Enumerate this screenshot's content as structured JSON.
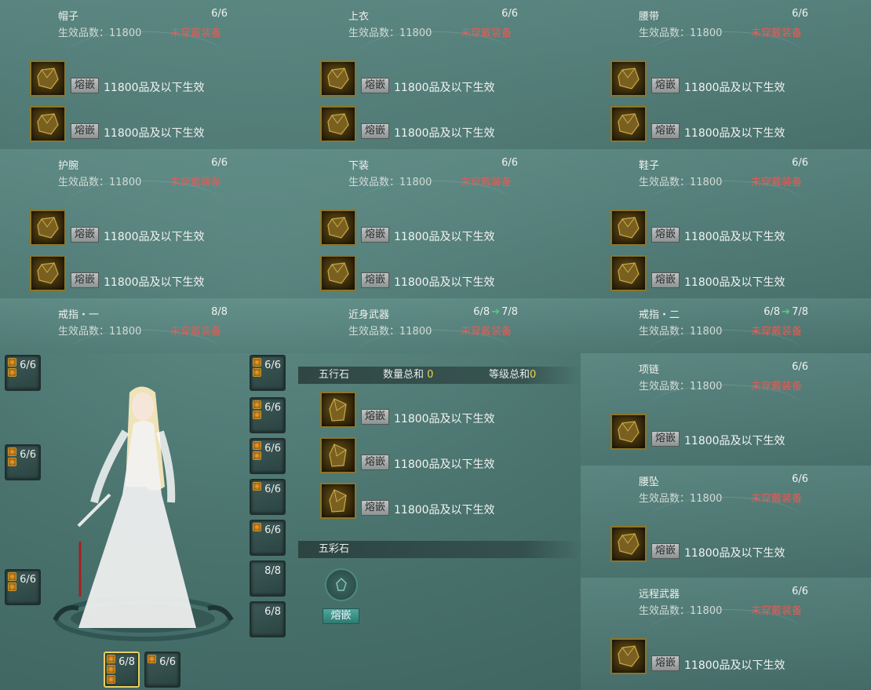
{
  "labels": {
    "effective_quality_prefix": "生效品数：",
    "not_equipped": "未穿戴装备",
    "inlay": "熔嵌",
    "gem_rule": "11800品及以下生效"
  },
  "slots": [
    {
      "name": "帽子",
      "count": "6/6",
      "quality": "11800"
    },
    {
      "name": "上衣",
      "count": "6/6",
      "quality": "11800"
    },
    {
      "name": "腰带",
      "count": "6/6",
      "quality": "11800"
    },
    {
      "name": "护腕",
      "count": "6/6",
      "quality": "11800"
    },
    {
      "name": "下装",
      "count": "6/6",
      "quality": "11800"
    },
    {
      "name": "鞋子",
      "count": "6/6",
      "quality": "11800"
    },
    {
      "name": "戒指・一",
      "count": "8/8",
      "quality": "11800"
    },
    {
      "name": "近身武器",
      "count": "6/8",
      "count_next": "7/8",
      "quality": "11800"
    },
    {
      "name": "戒指・二",
      "count": "6/8",
      "count_next": "7/8",
      "quality": "11800"
    },
    {
      "name": "项链",
      "count": "6/6",
      "quality": "11800"
    },
    {
      "name": "腰坠",
      "count": "6/6",
      "quality": "11800"
    },
    {
      "name": "远程武器",
      "count": "6/6",
      "quality": "11800"
    }
  ],
  "wuxing": {
    "title": "五行石",
    "count_label": "数量总和",
    "count_value": "0",
    "level_label": "等级总和",
    "level_value": "0"
  },
  "wucai": {
    "title": "五彩石",
    "button": "熔嵌"
  },
  "mini_slots": {
    "left": [
      "6/6",
      "6/6",
      "6/6"
    ],
    "right": [
      "6/6",
      "6/6",
      "6/6",
      "6/6",
      "6/6",
      "8/8",
      "6/8"
    ],
    "bottom": [
      "6/8",
      "6/6"
    ]
  },
  "colors": {
    "warning_red": "#e65b55",
    "highlight_yellow": "#f0d44a",
    "upgrade_green": "#4fd07a",
    "gem_border_gold": "#8c7628"
  }
}
